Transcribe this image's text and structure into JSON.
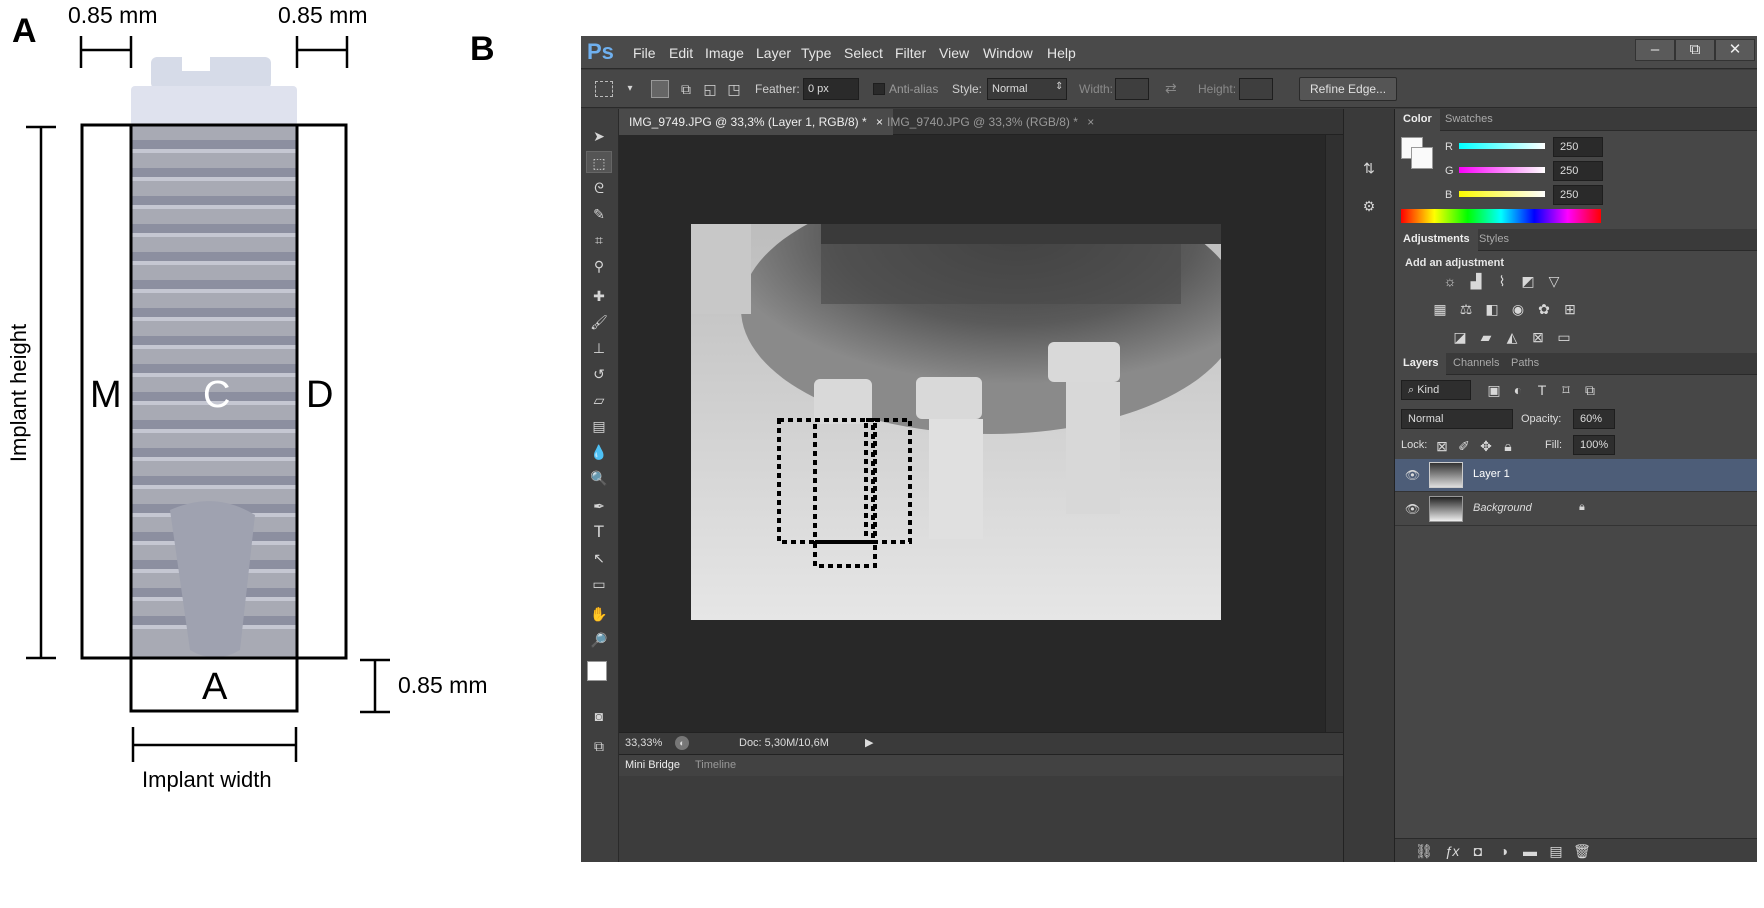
{
  "panel_a": {
    "letter": "A",
    "dim_left": "0.85 mm",
    "dim_right": "0.85 mm",
    "dim_bottom": "0.85 mm",
    "height_label": "Implant height",
    "width_label": "Implant width",
    "region_m": "M",
    "region_c": "C",
    "region_d": "D",
    "region_a": "A"
  },
  "panel_b": {
    "letter": "B"
  },
  "photoshop": {
    "logo": "Ps",
    "menu": [
      "File",
      "Edit",
      "Image",
      "Layer",
      "Type",
      "Select",
      "Filter",
      "View",
      "Window",
      "Help"
    ],
    "window_buttons": [
      "–",
      "⧉",
      "✕"
    ],
    "options": {
      "feather_label": "Feather:",
      "feather_value": "0 px",
      "antialias_label": "Anti-alias",
      "style_label": "Style:",
      "style_value": "Normal",
      "width_label": "Width:",
      "height_label": "Height:",
      "refine_edge": "Refine Edge..."
    },
    "tabs": [
      {
        "label": "IMG_9749.JPG @ 33,3% (Layer 1, RGB/8) *",
        "close": "×",
        "active": true
      },
      {
        "label": "IMG_9740.JPG @ 33,3% (RGB/8) *",
        "close": "×",
        "active": false
      }
    ],
    "status": {
      "zoom": "33,33%",
      "doc": "Doc: 5,30M/10,6M"
    },
    "bottom_tabs": [
      "Mini Bridge",
      "Timeline"
    ],
    "color_panel": {
      "tabs": [
        "Color",
        "Swatches"
      ],
      "r_label": "R",
      "r_value": "250",
      "g_label": "G",
      "g_value": "250",
      "b_label": "B",
      "b_value": "250"
    },
    "adjustments_panel": {
      "tabs": [
        "Adjustments",
        "Styles"
      ],
      "heading": "Add an adjustment"
    },
    "layers_panel": {
      "tabs": [
        "Layers",
        "Channels",
        "Paths"
      ],
      "kind_label": "Kind",
      "blend_mode": "Normal",
      "opacity_label": "Opacity:",
      "opacity_value": "60%",
      "lock_label": "Lock:",
      "fill_label": "Fill:",
      "fill_value": "100%",
      "layers": [
        {
          "name": "Layer 1",
          "selected": true
        },
        {
          "name": "Background",
          "selected": false
        }
      ]
    }
  },
  "colors": {
    "ps_bg": "#3c3c3c",
    "ps_accent": "#6fb0ef",
    "selection": "#4d5d78"
  }
}
